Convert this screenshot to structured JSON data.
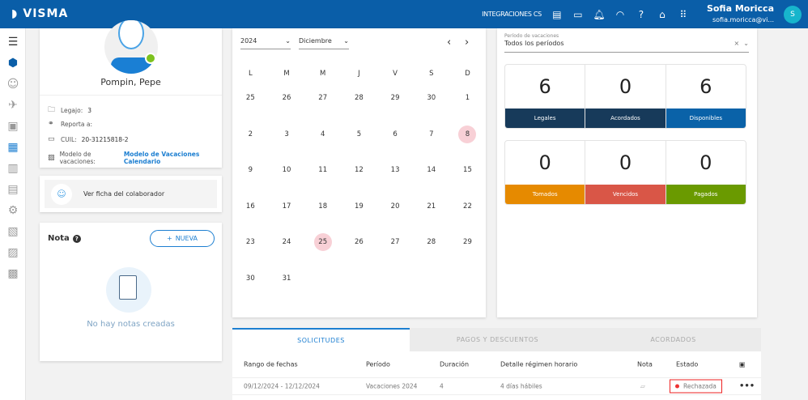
{
  "header": {
    "brand": "VISMA",
    "integraciones": "INTEGRACIONES CS",
    "user_name": "Sofia Moricca",
    "user_email": "sofia.moricca@vi...",
    "avatar_initial": "S",
    "color": "#0a5ea8"
  },
  "profile": {
    "name": "Pompin, Pepe",
    "legajo_label": "Legajo:",
    "legajo": "3",
    "reporta_label": "Reporta a:",
    "reporta": "",
    "cuil_label": "CUIL:",
    "cuil": "20-31215818-2",
    "modelo_label": "Modelo de vacaciones:",
    "modelo": "Modelo de Vacaciones Calendario",
    "status": "online"
  },
  "ficha": {
    "label": "Ver ficha del colaborador"
  },
  "nota": {
    "title": "Nota",
    "new_label": "NUEVA",
    "empty": "No hay notas creadas"
  },
  "calendar": {
    "year": "2024",
    "month": "Diciembre",
    "weekdays": [
      "L",
      "M",
      "M",
      "J",
      "V",
      "S",
      "D"
    ],
    "weeks": [
      [
        "25",
        "26",
        "27",
        "28",
        "29",
        "30",
        "1"
      ],
      [
        "2",
        "3",
        "4",
        "5",
        "6",
        "7",
        "8"
      ],
      [
        "9",
        "10",
        "11",
        "12",
        "13",
        "14",
        "15"
      ],
      [
        "16",
        "17",
        "18",
        "19",
        "20",
        "21",
        "22"
      ],
      [
        "23",
        "24",
        "25",
        "26",
        "27",
        "28",
        "29"
      ],
      [
        "30",
        "31",
        "",
        "",
        "",
        "",
        ""
      ]
    ],
    "highlighted": [
      [
        1,
        6
      ],
      [
        4,
        2
      ]
    ]
  },
  "summary": {
    "period_label": "Período de vacaciones",
    "period": "Todos los períodos",
    "row1": [
      {
        "value": "6",
        "label": "Legales",
        "color": "#173a5a"
      },
      {
        "value": "0",
        "label": "Acordados",
        "color": "#173a5a"
      },
      {
        "value": "6",
        "label": "Disponibles",
        "color": "#0a62a8"
      }
    ],
    "row2": [
      {
        "value": "0",
        "label": "Tomados",
        "color": "#e68a00"
      },
      {
        "value": "0",
        "label": "Vencidos",
        "color": "#d95647"
      },
      {
        "value": "0",
        "label": "Pagados",
        "color": "#6a9a00"
      }
    ]
  },
  "tabs": [
    "SOLICITUDES",
    "PAGOS Y DESCUENTOS",
    "ACORDADOS"
  ],
  "table": {
    "headers": [
      "Rango de fechas",
      "Período",
      "Duración",
      "Detalle régimen horario",
      "Nota",
      "Estado"
    ],
    "rows": [
      {
        "rango": "09/12/2024 - 12/12/2024",
        "periodo": "Vacaciones 2024",
        "duracion": "4",
        "detalle": "4 días hábiles",
        "estado": "Rechazada"
      }
    ]
  }
}
